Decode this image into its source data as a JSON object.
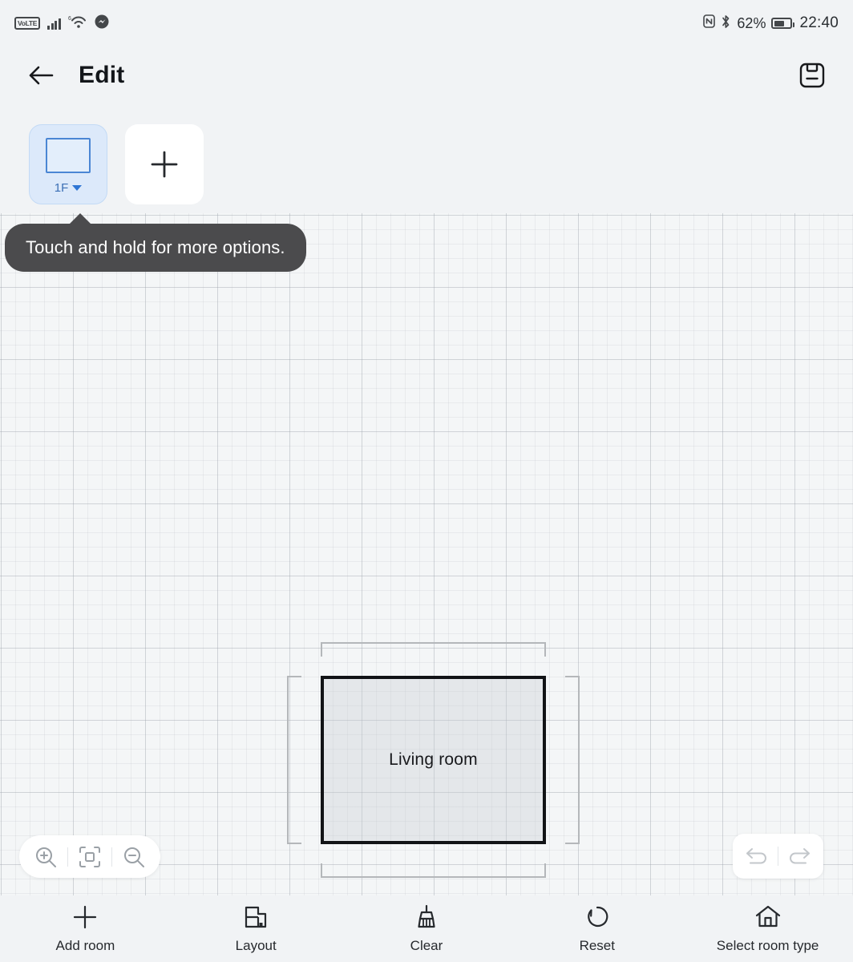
{
  "status_bar": {
    "volte_label": "VoLTE",
    "icons": [
      "volte-badge",
      "signal-bars-icon",
      "wifi6-icon",
      "messenger-icon",
      "nfc-icon",
      "bluetooth-icon"
    ],
    "wifi_superscript": "6",
    "battery_percent": "62%",
    "battery_level": 62,
    "time": "22:40"
  },
  "app_bar": {
    "back_icon": "arrow-left-icon",
    "title": "Edit",
    "save_icon": "save-floppy-icon"
  },
  "floors": {
    "items": [
      {
        "label": "1F",
        "selected": true,
        "caret_icon": "chevron-down-icon",
        "thumb_icon": "floorplan-thumbnail"
      }
    ],
    "add_label": "+",
    "add_icon": "plus-icon"
  },
  "tooltip": {
    "text": "Touch and hold for more options."
  },
  "canvas": {
    "rooms": [
      {
        "name": "Living room",
        "selected": true
      }
    ],
    "selection_handles": [
      "top",
      "bottom",
      "left",
      "right"
    ]
  },
  "zoom_controls": [
    {
      "name": "zoom-in",
      "icon": "magnifier-plus-icon"
    },
    {
      "name": "fit-to-screen",
      "icon": "fit-frame-icon"
    },
    {
      "name": "zoom-out",
      "icon": "magnifier-minus-icon"
    }
  ],
  "history_controls": [
    {
      "name": "undo",
      "icon": "undo-arrow-icon",
      "enabled": false
    },
    {
      "name": "redo",
      "icon": "redo-arrow-icon",
      "enabled": false
    }
  ],
  "bottom_nav": [
    {
      "label": "Add room",
      "icon": "plus-icon"
    },
    {
      "label": "Layout",
      "icon": "layout-icon"
    },
    {
      "label": "Clear",
      "icon": "broom-icon"
    },
    {
      "label": "Reset",
      "icon": "reset-circular-arrow-icon"
    },
    {
      "label": "Select room type",
      "icon": "house-icon"
    }
  ],
  "colors": {
    "page_background": "#f1f3f5",
    "canvas_background": "#f4f6f7",
    "accent_blue": "#2e75d4",
    "selected_card_bg": "#dce9fa",
    "tooltip_bg": "#4b4b4d",
    "room_border": "#111316",
    "text_primary": "#13161a"
  }
}
